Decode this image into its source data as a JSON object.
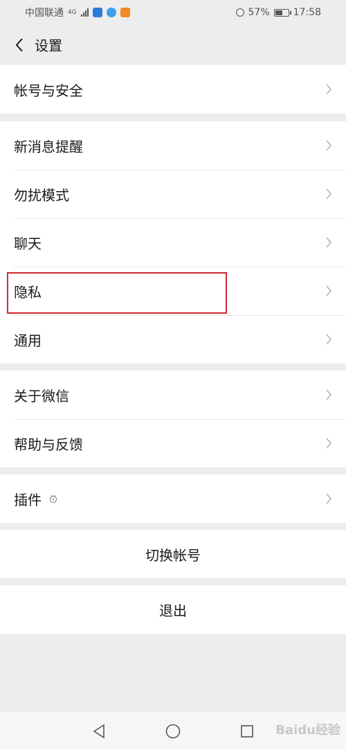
{
  "status_bar": {
    "carrier": "中国联通",
    "network": "4G",
    "battery_percent": "57%",
    "battery_level": 0.57,
    "time": "17:58"
  },
  "nav": {
    "title": "设置",
    "back_icon": "chevron-left-icon"
  },
  "groups": {
    "account": {
      "items": [
        {
          "label": "帐号与安全"
        }
      ]
    },
    "main": {
      "items": [
        {
          "label": "新消息提醒"
        },
        {
          "label": "勿扰模式"
        },
        {
          "label": "聊天"
        },
        {
          "label": "隐私"
        },
        {
          "label": "通用"
        }
      ]
    },
    "about": {
      "items": [
        {
          "label": "关于微信"
        },
        {
          "label": "帮助与反馈"
        }
      ]
    },
    "plugins": {
      "items": [
        {
          "label": "插件"
        }
      ]
    }
  },
  "actions": {
    "switch_account": "切换帐号",
    "logout": "退出"
  },
  "highlight": {
    "color": "#d0262d",
    "target": "隐私"
  },
  "bottom_nav": {
    "back_icon": "triangle-back-icon",
    "home_icon": "circle-home-icon",
    "recent_icon": "square-recent-icon"
  },
  "watermark": "Baidu经验",
  "colors": {
    "background": "#ededed",
    "row_background": "#ffffff",
    "chevron": "#b2b2b2",
    "text": "#1a1a1a"
  }
}
